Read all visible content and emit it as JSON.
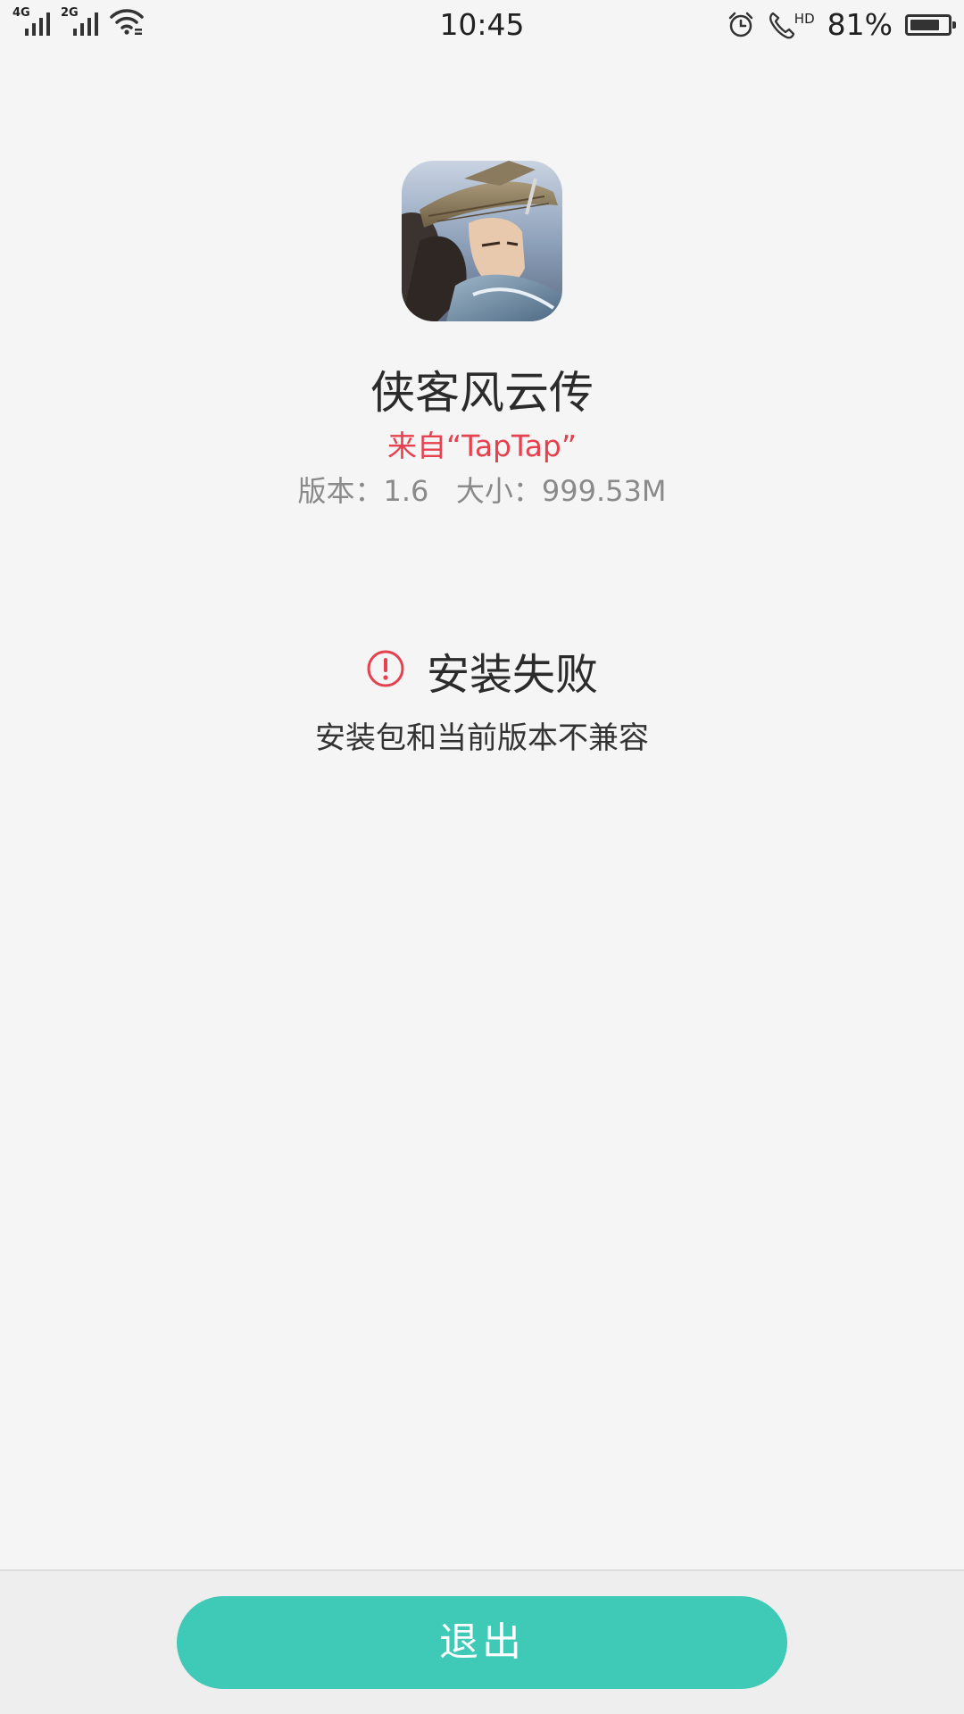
{
  "status_bar": {
    "network_1": "4G",
    "network_2": "2G",
    "time": "10:45",
    "hd": "HD",
    "battery_percent": "81%",
    "battery_level": 0.81,
    "icons": [
      "signal-icon",
      "wifi-icon",
      "alarm-icon",
      "call-hd-icon",
      "battery-icon"
    ]
  },
  "app": {
    "icon": "app-icon",
    "name": "侠客风云传",
    "source": "来自“TapTap”",
    "version_label": "版本：1.6",
    "size_label": "大小：999.53M"
  },
  "result": {
    "icon": "warning-circle-icon",
    "title": "安装失败",
    "message": "安装包和当前版本不兼容"
  },
  "actions": {
    "exit_label": "退出"
  },
  "colors": {
    "background": "#f5f5f5",
    "accent": "#3fc9b7",
    "error": "#e5414f",
    "text_primary": "#2b2b2b",
    "text_secondary": "#8a8a8a"
  }
}
